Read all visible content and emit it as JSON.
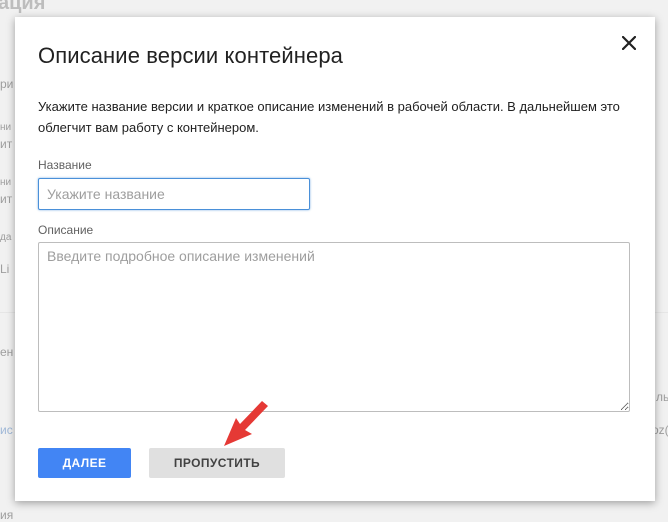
{
  "background": {
    "fragments": [
      "ация",
      "ри",
      "ни",
      "ит",
      "ни",
      "ит",
      "да",
      "Li",
      "ен",
      "ис",
      "ия",
      "ль",
      "oz("
    ]
  },
  "dialog": {
    "title": "Описание версии контейнера",
    "close_icon": "close-icon",
    "intro": "Укажите название версии и краткое описание изменений в рабочей области. В дальнейшем это облегчит вам работу с контейнером.",
    "name": {
      "label": "Название",
      "value": "",
      "placeholder": "Укажите название"
    },
    "description": {
      "label": "Описание",
      "value": "",
      "placeholder": "Введите подробное описание изменений"
    },
    "buttons": {
      "next": "ДАЛЕЕ",
      "skip": "ПРОПУСТИТЬ"
    }
  },
  "annotation": {
    "arrow_color": "#e53935"
  },
  "colors": {
    "primary_button": "#4285f4",
    "secondary_button": "#e0e0e0",
    "input_focus": "#4a90d9"
  }
}
